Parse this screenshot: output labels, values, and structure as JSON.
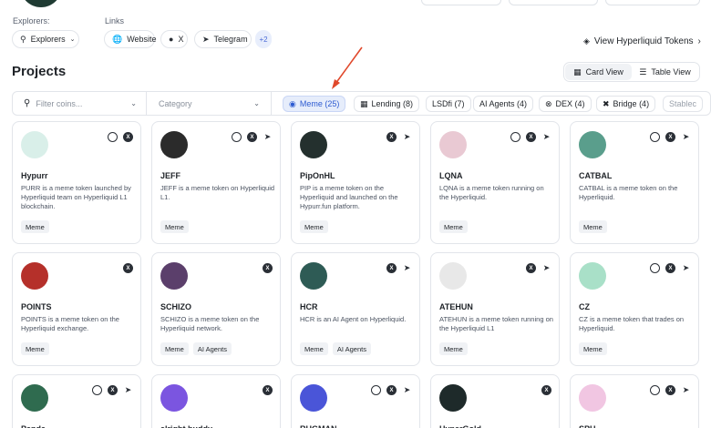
{
  "explorers": {
    "label": "Explorers:",
    "button": "Explorers"
  },
  "links": {
    "label": "Links",
    "items": [
      {
        "label": "Website",
        "icon": "globe-icon"
      },
      {
        "label": "X",
        "icon": "x-icon"
      },
      {
        "label": "Telegram",
        "icon": "telegram-icon"
      }
    ],
    "more": "+2"
  },
  "view_tokens": "View Hyperliquid Tokens",
  "projects_title": "Projects",
  "view_toggle": {
    "card": "Card View",
    "table": "Table View",
    "active": "card"
  },
  "filters": {
    "search_placeholder": "Filter coins...",
    "category_placeholder": "Category",
    "pills": [
      {
        "label": "Meme (25)",
        "icon": "meme-icon",
        "active": true
      },
      {
        "label": "Lending (8)",
        "icon": "lending-icon",
        "active": false
      },
      {
        "label": "LSDfi (7)",
        "icon": "",
        "active": false
      },
      {
        "label": "AI Agents (4)",
        "icon": "",
        "active": false
      },
      {
        "label": "DEX (4)",
        "icon": "dex-icon",
        "active": false
      },
      {
        "label": "Bridge (4)",
        "icon": "bridge-icon",
        "active": false
      },
      {
        "label": "Stablec",
        "icon": "",
        "active": false
      }
    ]
  },
  "cards": [
    {
      "name": "Hypurr",
      "desc": "PURR is a meme token launched by Hyperliquid team on Hyperliquid L1 blockchain.",
      "tags": [
        "Meme"
      ],
      "links": [
        "web",
        "x"
      ],
      "avatar_color": "#d9efe9"
    },
    {
      "name": "JEFF",
      "desc": "JEFF is a meme token on Hyperliquid L1.",
      "tags": [
        "Meme"
      ],
      "links": [
        "web",
        "x",
        "tg"
      ],
      "avatar_color": "#2b2b2b"
    },
    {
      "name": "PipOnHL",
      "desc": "PIP is a meme token on the Hyperliquid and launched on the Hypurr.fun platform.",
      "tags": [
        "Meme"
      ],
      "links": [
        "x",
        "tg"
      ],
      "avatar_color": "#24302e"
    },
    {
      "name": "LQNA",
      "desc": "LQNA is a meme token running on the Hyperliquid.",
      "tags": [
        "Meme"
      ],
      "links": [
        "web",
        "x",
        "tg"
      ],
      "avatar_color": "#e9c9d3"
    },
    {
      "name": "CATBAL",
      "desc": "CATBAL is a meme token on the Hyperliquid.",
      "tags": [
        "Meme"
      ],
      "links": [
        "web",
        "x",
        "tg"
      ],
      "avatar_color": "#5a9e8c"
    },
    {
      "name": "POINTS",
      "desc": "POINTS is a meme token on the Hyperliquid exchange.",
      "tags": [
        "Meme"
      ],
      "links": [
        "x"
      ],
      "avatar_color": "#b5302a"
    },
    {
      "name": "SCHIZO",
      "desc": "SCHIZO is a meme token on the Hyperliquid network.",
      "tags": [
        "Meme",
        "AI Agents"
      ],
      "links": [
        "x"
      ],
      "avatar_color": "#5b3f6b"
    },
    {
      "name": "HCR",
      "desc": "HCR is an AI Agent on Hyperliquid.",
      "tags": [
        "Meme",
        "AI Agents"
      ],
      "links": [
        "x",
        "tg"
      ],
      "avatar_color": "#2e5b55"
    },
    {
      "name": "ATEHUN",
      "desc": "ATEHUN is a meme token running on the Hyperliquid L1",
      "tags": [
        "Meme"
      ],
      "links": [
        "x",
        "tg"
      ],
      "avatar_color": "#e8e8e8"
    },
    {
      "name": "CZ",
      "desc": "CZ is a meme token that trades on Hyperliquid.",
      "tags": [
        "Meme"
      ],
      "links": [
        "web",
        "x",
        "tg"
      ],
      "avatar_color": "#a9e0c8"
    },
    {
      "name": "Panda",
      "desc": "",
      "tags": [],
      "links": [
        "web",
        "x",
        "tg"
      ],
      "avatar_color": "#2f6b4f"
    },
    {
      "name": "alright buddy",
      "desc": "",
      "tags": [],
      "links": [
        "x"
      ],
      "avatar_color": "#7b55e0"
    },
    {
      "name": "RUGMAN",
      "desc": "",
      "tags": [],
      "links": [
        "web",
        "x",
        "tg"
      ],
      "avatar_color": "#4a55d8"
    },
    {
      "name": "HyperGold",
      "desc": "",
      "tags": [],
      "links": [
        "x"
      ],
      "avatar_color": "#1e2a2a"
    },
    {
      "name": "SPH",
      "desc": "",
      "tags": [],
      "links": [
        "web",
        "x",
        "tg"
      ],
      "avatar_color": "#f1c6e2"
    }
  ]
}
